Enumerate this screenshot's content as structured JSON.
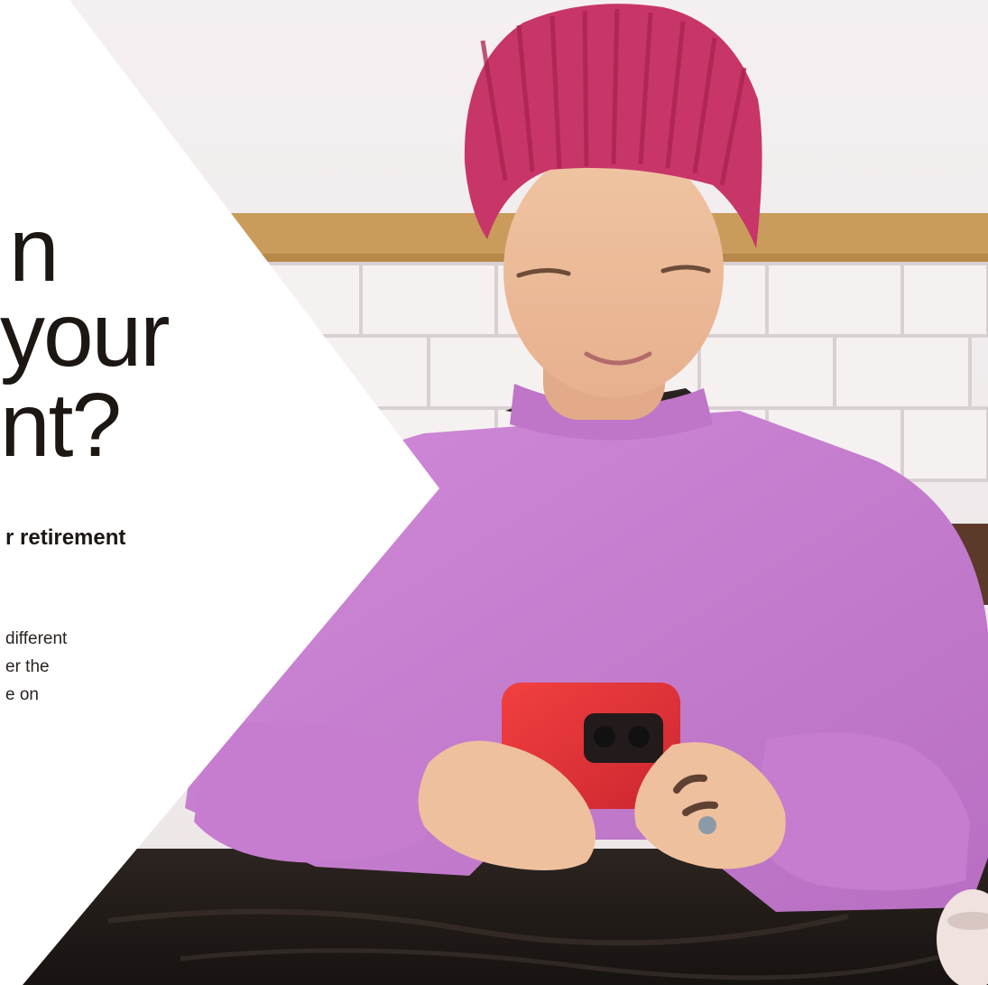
{
  "hero": {
    "heading_lines": [
      "n",
      "your",
      "nt?"
    ],
    "subheading": "r retirement",
    "body_lines": [
      "different",
      "er the",
      "e on"
    ]
  },
  "colors": {
    "panel": "#ffffff",
    "text": "#1d1714",
    "beanie": "#c83568",
    "sweater": "#c97bd0",
    "phone": "#e8373b",
    "wall": "#efe9ea",
    "shelf": "#c99c5b",
    "table": "#211b18"
  },
  "image": {
    "description_icon": "person-using-phone-photo"
  }
}
